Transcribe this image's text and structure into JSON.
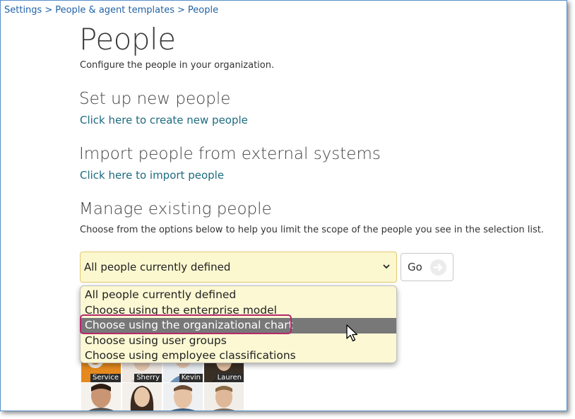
{
  "breadcrumb": [
    {
      "label": "Settings"
    },
    {
      "label": "People & agent templates"
    },
    {
      "label": "People"
    }
  ],
  "breadcrumb_sep": ">",
  "page": {
    "title": "People",
    "subtitle": "Configure the people in your organization."
  },
  "setup": {
    "title": "Set up new people",
    "link": "Click here to create new people"
  },
  "import": {
    "title": "Import people from external systems",
    "link": "Click here to import people"
  },
  "manage": {
    "title": "Manage existing people",
    "description": "Choose from the options below to help you limit the scope of the people you see in the selection list.",
    "select": {
      "selected": "All people currently defined",
      "options": [
        "All people currently defined",
        "Choose using the enterprise model",
        "Choose using the organizational chart",
        "Choose using user groups",
        "Choose using employee classifications"
      ],
      "highlighted_index": 2
    },
    "go_label": "Go"
  },
  "people_tiles": [
    {
      "caption": "Service",
      "icon": "service-avatar"
    },
    {
      "caption": "Sherry",
      "icon": "person-photo"
    },
    {
      "caption": "Kevin",
      "icon": "person-photo"
    },
    {
      "caption": "Lauren",
      "icon": "person-photo"
    },
    {
      "caption": "",
      "icon": "person-photo"
    },
    {
      "caption": "",
      "icon": "person-photo"
    },
    {
      "caption": "",
      "icon": "person-photo"
    },
    {
      "caption": "",
      "icon": "person-photo"
    }
  ],
  "colors": {
    "link": "#1d6b7f",
    "breadcrumb_link": "#2263a6",
    "select_bg": "#fbf7cf",
    "dropdown_selected": "#787878",
    "annotation": "#b5276d"
  }
}
